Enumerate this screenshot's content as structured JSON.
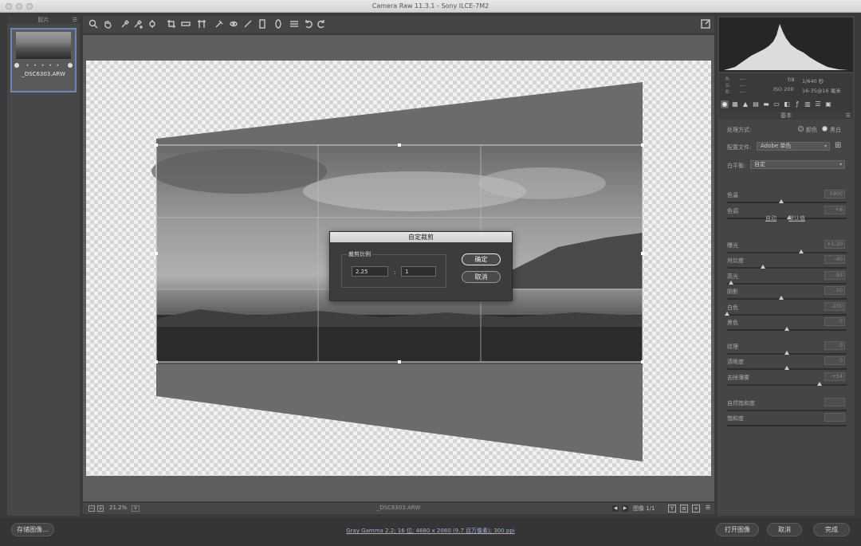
{
  "window": {
    "title": "Camera Raw 11.3.1 -  Sony ILCE-7M2"
  },
  "filmstrip": {
    "header": "胶片",
    "thumbnail": {
      "filename": "_DSC6303.ARW",
      "rating": "• • • • •"
    }
  },
  "toolbar": {
    "tools": [
      "zoom-icon",
      "hand-icon",
      "white-balance-icon",
      "color-sampler-icon",
      "target-adjust-icon",
      "crop-icon",
      "straighten-icon",
      "transform-icon",
      "spot-removal-icon",
      "red-eye-icon",
      "adjustment-brush-icon",
      "graduated-filter-icon",
      "radial-filter-icon",
      "preferences-icon",
      "rotate-left-icon",
      "rotate-right-icon"
    ],
    "fullscreen_icon": "fullscreen-icon"
  },
  "crop_dialog": {
    "title": "自定裁剪",
    "legend": "裁剪比例",
    "ratio_w": "2.25",
    "ratio_h": "1",
    "colon": ":",
    "ok_label": "确定",
    "cancel_label": "取消"
  },
  "statusbar": {
    "zoom_minus": "−",
    "zoom_plus": "+",
    "zoom": "21.2%",
    "zoom_dropdown": "∨",
    "filename": "_DSC6303.ARW",
    "prev": "◀",
    "next": "▶",
    "page": "图像 1/1",
    "view_y": "Y",
    "view_compare": "≡",
    "view_swap": "+",
    "view_settings": "☰"
  },
  "right_panel": {
    "rgb": {
      "r": "R:",
      "g": "G:",
      "b": "B:",
      "r_val": "---",
      "g_val": "---",
      "b_val": "---"
    },
    "exposure": {
      "aperture": "f/8",
      "shutter": "1/640 秒",
      "iso": "ISO 200",
      "lens": "16-35@16 毫米"
    },
    "section": "基本",
    "treatment_label": "处理方式:",
    "treatment_color": "颜色",
    "treatment_bw": "黑白",
    "profile_label": "配置文件:",
    "profile_value": "Adobe 单色",
    "wb_label": "白平衡:",
    "wb_value": "自定",
    "auto_link": "自动",
    "default_link": "默认值",
    "sliders": [
      {
        "label": "色温",
        "value": "5900",
        "pos": 0.45
      },
      {
        "label": "色调",
        "value": "+8",
        "pos": 0.52
      },
      {
        "label": "曝光",
        "value": "+1.20",
        "pos": 0.62
      },
      {
        "label": "对比度",
        "value": "-40",
        "pos": 0.3
      },
      {
        "label": "高光",
        "value": "-93",
        "pos": 0.03
      },
      {
        "label": "阴影",
        "value": "-10",
        "pos": 0.45
      },
      {
        "label": "白色",
        "value": "-100",
        "pos": 0.0
      },
      {
        "label": "黑色",
        "value": "0",
        "pos": 0.5
      },
      {
        "label": "纹理",
        "value": "0",
        "pos": 0.5
      },
      {
        "label": "清晰度",
        "value": "0",
        "pos": 0.5
      },
      {
        "label": "去除薄雾",
        "value": "+54",
        "pos": 0.77
      },
      {
        "label": "自然饱和度",
        "value": "",
        "pos": -1
      },
      {
        "label": "饱和度",
        "value": "",
        "pos": -1
      }
    ]
  },
  "bottombar": {
    "save_label": "存储图像...",
    "info": "Gray Gamma 2.2; 16 位; 4680 x 2080 (9.7 百万像素); 300 ppi",
    "open_label": "打开图像",
    "cancel_label": "取消",
    "done_label": "完成"
  }
}
